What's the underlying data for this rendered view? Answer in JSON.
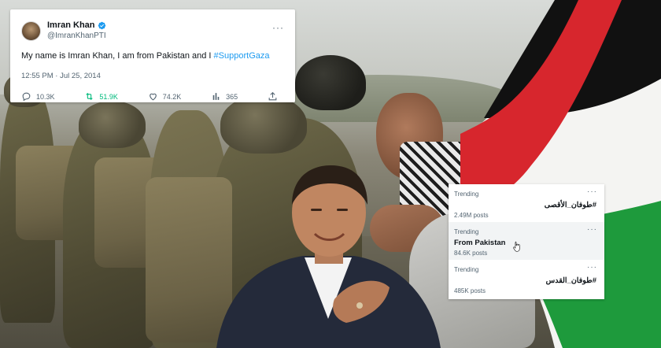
{
  "tweet": {
    "name": "Imran Khan",
    "handle": "@ImranKhanPTI",
    "text": "My name is Imran Khan, I am from Pakistan and I ",
    "hashtag": "#SupportGaza",
    "timestamp": "12:55 PM · Jul 25, 2014",
    "replies": "10.3K",
    "retweets": "51.9K",
    "likes": "74.2K",
    "views": "365",
    "more_icon": "···"
  },
  "trends": [
    {
      "label": "Trending",
      "title": "#طوفان_الأقصى",
      "count": "2.49M posts",
      "rtl": true
    },
    {
      "label": "Trending",
      "title": "From Pakistan",
      "count": "84.6K posts",
      "rtl": false
    },
    {
      "label": "Trending",
      "title": "#طوفان_القدس",
      "count": "485K posts",
      "rtl": true
    }
  ],
  "trend_more_icon": "···",
  "colors": {
    "accent": "#1d9bf0",
    "retweet": "#00ba7c",
    "flag_red": "#d7262d",
    "flag_green": "#1e9a3c",
    "flag_black": "#111111"
  },
  "icons": [
    "verified-badge-icon",
    "reply-icon",
    "retweet-icon",
    "like-icon",
    "views-icon",
    "share-icon",
    "more-icon",
    "pointer-cursor-icon"
  ]
}
